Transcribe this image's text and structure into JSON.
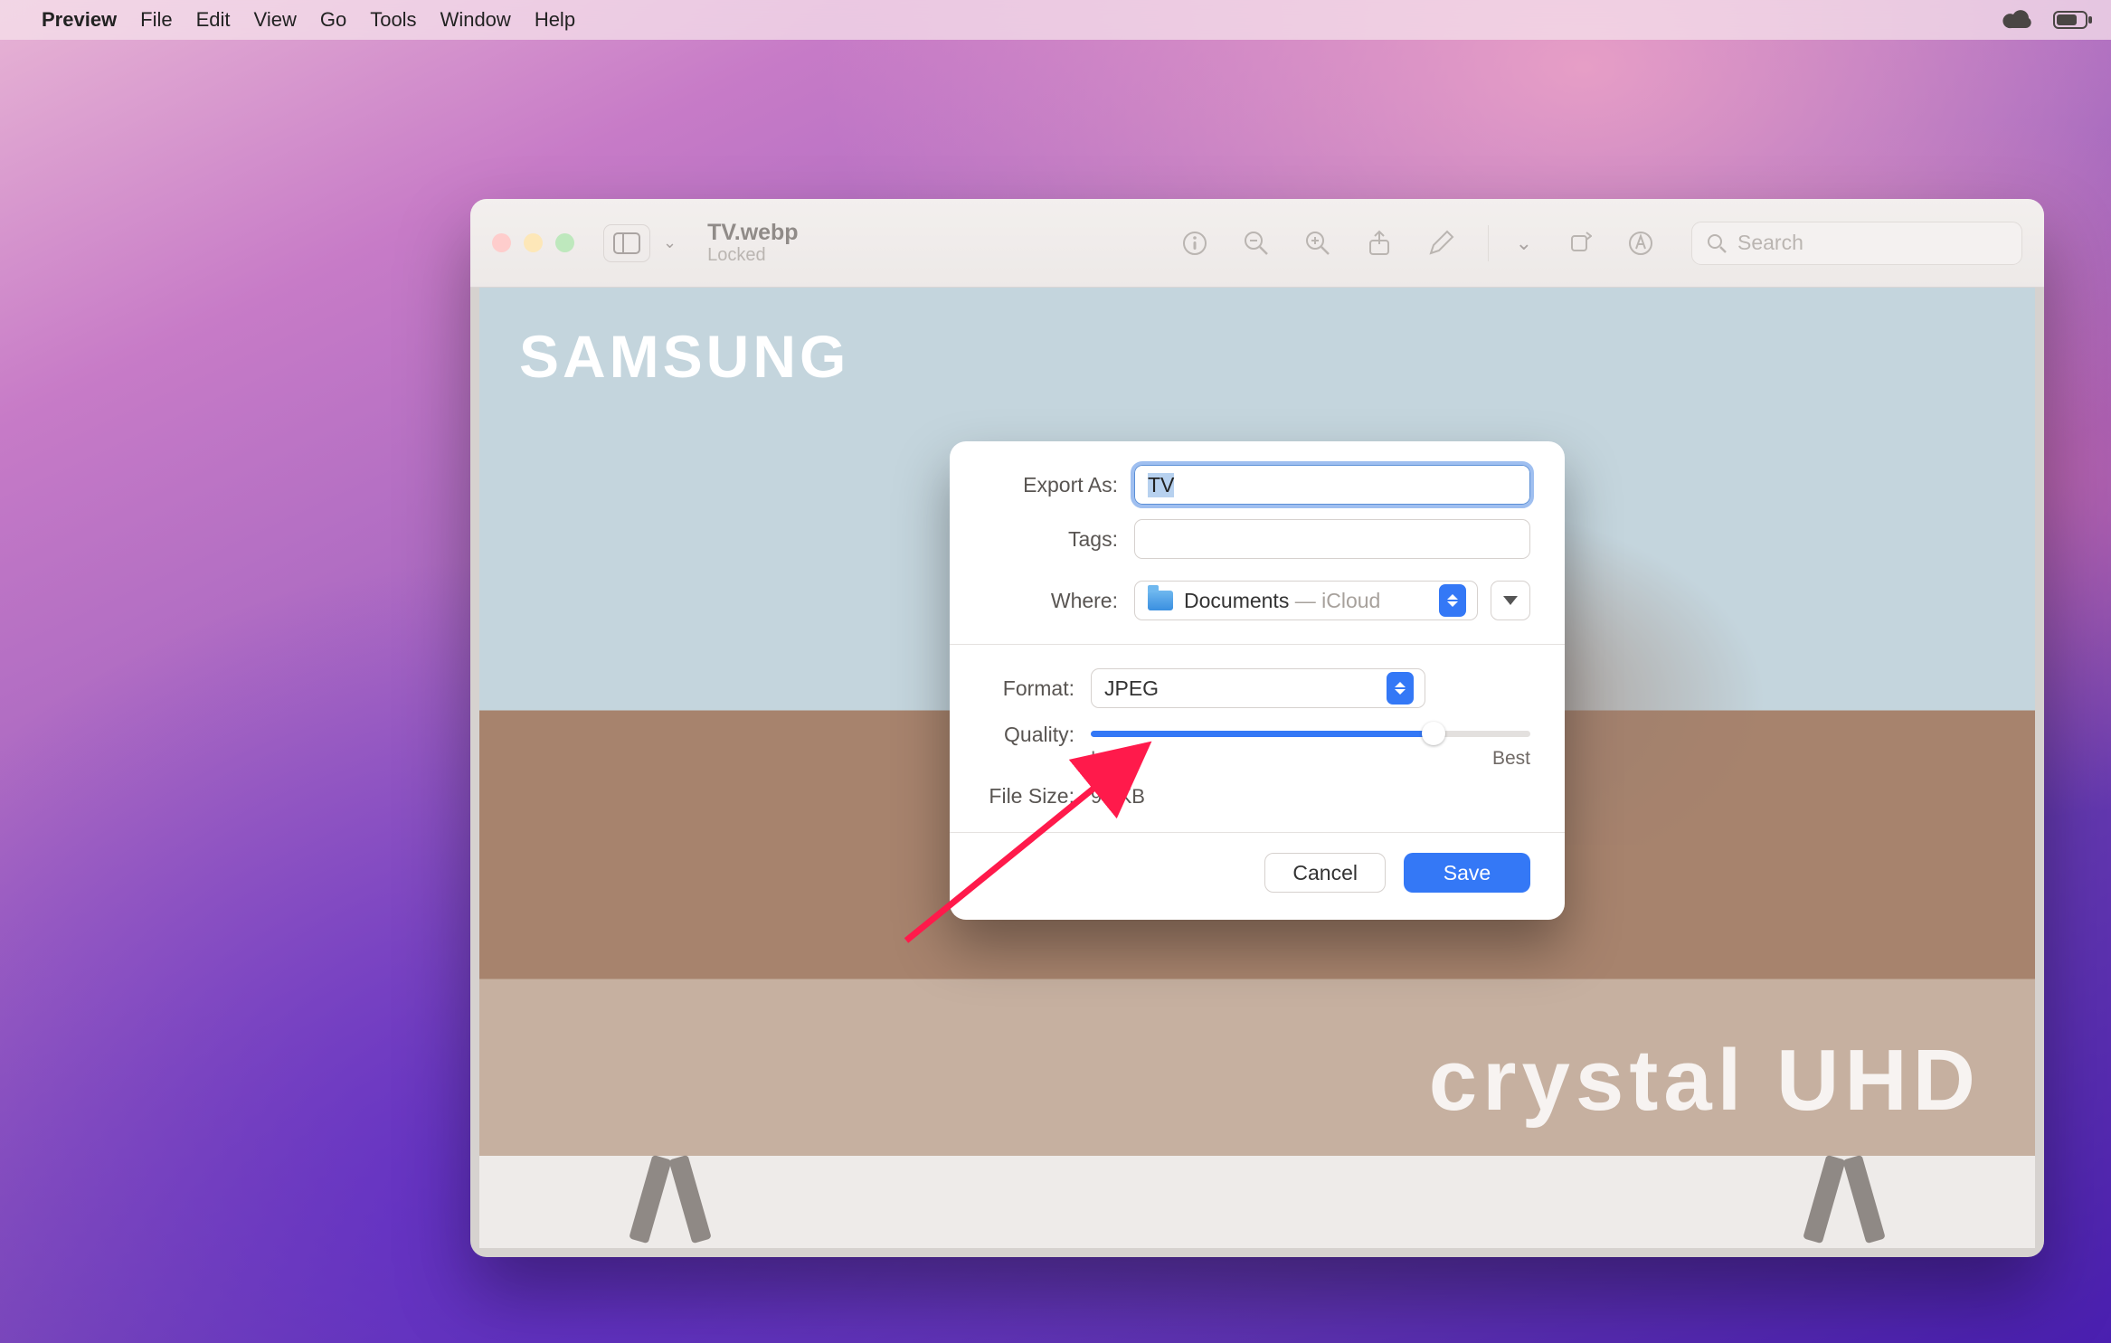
{
  "menubar": {
    "app": "Preview",
    "items": [
      "File",
      "Edit",
      "View",
      "Go",
      "Tools",
      "Window",
      "Help"
    ]
  },
  "window": {
    "title": "TV.webp",
    "subtitle": "Locked",
    "search_placeholder": "Search"
  },
  "content": {
    "brand": "SAMSUNG",
    "tagline": "crystal UHD"
  },
  "sheet": {
    "export_as_label": "Export As:",
    "export_as_value": "TV",
    "tags_label": "Tags:",
    "tags_value": "",
    "where_label": "Where:",
    "where_folder": "Documents",
    "where_suffix": " — iCloud",
    "format_label": "Format:",
    "format_value": "JPEG",
    "quality_label": "Quality:",
    "quality_min": "Least",
    "quality_max": "Best",
    "filesize_label": "File Size:",
    "filesize_value": "94 KB",
    "cancel": "Cancel",
    "save": "Save"
  }
}
